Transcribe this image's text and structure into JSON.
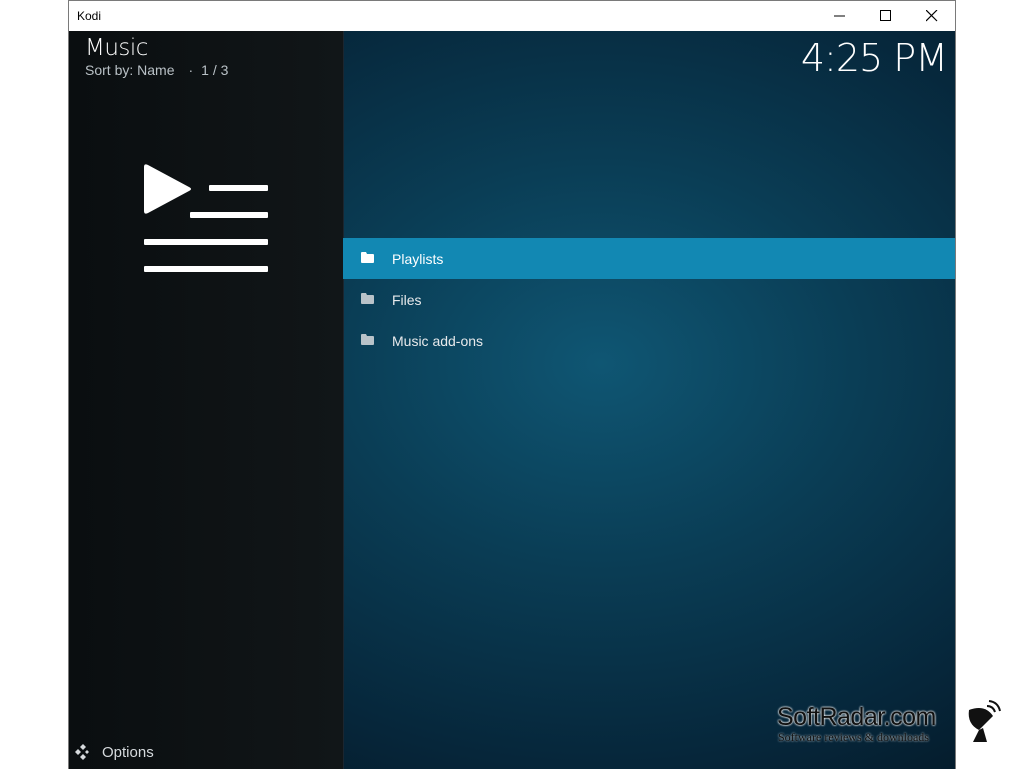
{
  "window": {
    "title": "Kodi"
  },
  "header": {
    "app_title": "Music",
    "sort_label": "Sort by: Name",
    "separator": "·",
    "position": "1 / 3",
    "clock": "4:25 PM"
  },
  "sidebar": {
    "options_label": "Options"
  },
  "list": [
    {
      "label": "Playlists",
      "selected": true
    },
    {
      "label": "Files",
      "selected": false
    },
    {
      "label": "Music add-ons",
      "selected": false
    }
  ],
  "watermark": {
    "name": "SoftRadar.com",
    "tagline": "Software reviews & downloads"
  },
  "colors": {
    "accent": "#1288b3",
    "background": "#0a3d55",
    "sidebar": "#0e1214"
  }
}
